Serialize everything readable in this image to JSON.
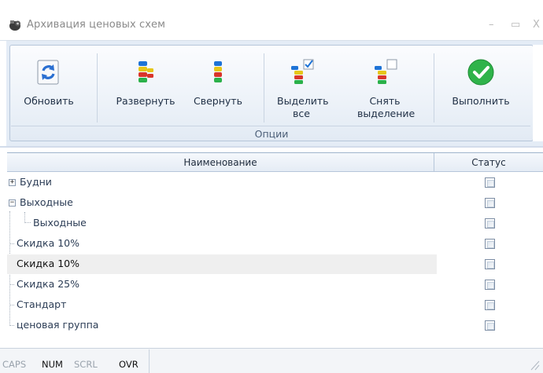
{
  "window": {
    "title": "Архивация ценовых схем",
    "minimize_glyph": "–",
    "maximize_glyph": "▭",
    "close_glyph": "X"
  },
  "ribbon": {
    "buttons": [
      {
        "id": "refresh",
        "label": "Обновить",
        "icon": "refresh-icon"
      },
      {
        "id": "expand",
        "label": "Развернуть",
        "icon": "tree-expand-icon"
      },
      {
        "id": "collapse",
        "label": "Свернуть",
        "icon": "tree-collapse-icon"
      },
      {
        "id": "select_all",
        "label": "Выделить все",
        "icon": "select-all-icon"
      },
      {
        "id": "deselect",
        "label": "Снять выделение",
        "icon": "deselect-icon"
      },
      {
        "id": "execute",
        "label": "Выполнить",
        "icon": "checkmark-icon"
      }
    ],
    "group_label": "Опции"
  },
  "grid": {
    "columns": [
      "Наименование",
      "Статус"
    ],
    "rows": [
      {
        "name": "Будни",
        "level": 0,
        "expander": "+",
        "checked": false,
        "selected": false
      },
      {
        "name": "Выходные",
        "level": 0,
        "expander": "−",
        "checked": false,
        "selected": false
      },
      {
        "name": "Выходные",
        "level": 1,
        "expander": null,
        "checked": false,
        "selected": false
      },
      {
        "name": "Скидка 10%",
        "level": 0,
        "expander": null,
        "checked": false,
        "selected": false
      },
      {
        "name": "Скидка 10%",
        "level": 0,
        "expander": null,
        "checked": false,
        "selected": true
      },
      {
        "name": "Скидка 25%",
        "level": 0,
        "expander": null,
        "checked": false,
        "selected": false
      },
      {
        "name": "Стандарт",
        "level": 0,
        "expander": null,
        "checked": false,
        "selected": false
      },
      {
        "name": "ценовая группа",
        "level": 0,
        "expander": null,
        "checked": false,
        "selected": false
      }
    ]
  },
  "statusbar": {
    "items": [
      {
        "label": "CAPS",
        "active": false
      },
      {
        "label": "NUM",
        "active": true
      },
      {
        "label": "SCRL",
        "active": false
      },
      {
        "label": "OVR",
        "active": true
      }
    ]
  },
  "colors": {
    "accent_green": "#2fb34a",
    "refresh_blue": "#2a6fd1",
    "ribbon_bg": "#e4ecf6",
    "selected_row": "#efefef"
  }
}
